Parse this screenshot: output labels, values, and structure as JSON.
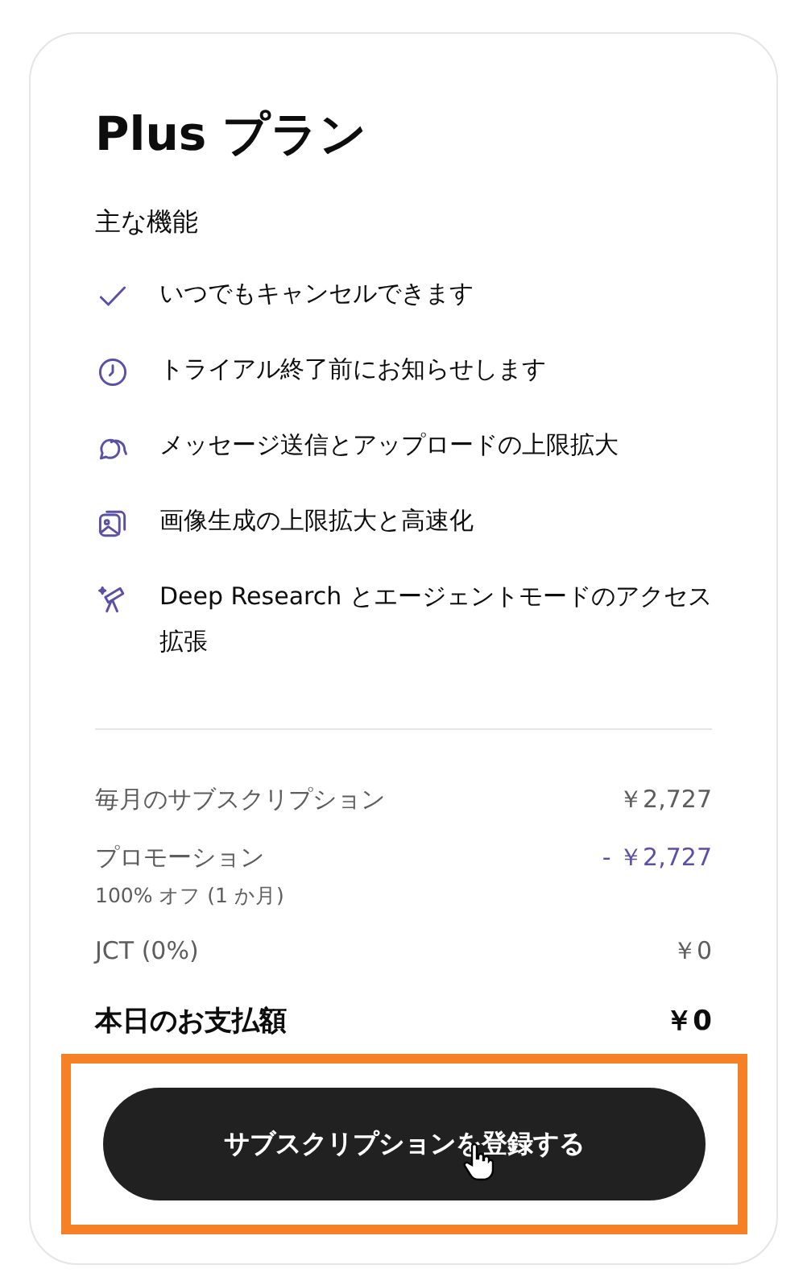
{
  "plan": {
    "title": "Plus プラン",
    "features_heading": "主な機能",
    "features": [
      {
        "kind": "check",
        "text": "いつでもキャンセルできます"
      },
      {
        "kind": "clock",
        "text": "トライアル終了前にお知らせします"
      },
      {
        "kind": "chat",
        "text": "メッセージ送信とアップロードの上限拡大"
      },
      {
        "kind": "image",
        "text": "画像生成の上限拡大と高速化"
      },
      {
        "kind": "telescope",
        "text": "Deep Research とエージェントモードのアクセス拡張"
      }
    ],
    "charges": [
      {
        "label": "毎月のサブスクリプション",
        "amount": "￥2,727",
        "color": "#5d5d5d"
      },
      {
        "label": "プロモーション",
        "note": "100% オフ (1 か月)",
        "amount": "- ￥2,727",
        "color": "#5b50a8"
      },
      {
        "label": "JCT (0%)",
        "amount": "￥0",
        "color": "#5d5d5d"
      }
    ],
    "total": {
      "label": "本日のお支払額",
      "amount": "￥0"
    },
    "button": {
      "label": "サブスクリプションを登録する",
      "highlighted": true,
      "hovered": true
    }
  }
}
